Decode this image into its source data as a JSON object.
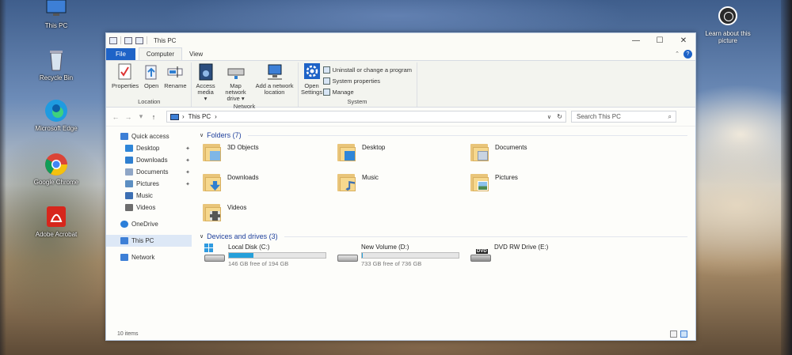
{
  "desktop": {
    "icons": [
      {
        "label": "This PC"
      },
      {
        "label": "Recycle Bin"
      },
      {
        "label": "Microsoft Edge"
      },
      {
        "label": "Google Chrome"
      },
      {
        "label": "Adobe Acrobat"
      }
    ],
    "learn_about": "Learn about this picture"
  },
  "window": {
    "title": "This PC",
    "controls": {
      "minimize": "—",
      "maximize": "☐",
      "close": "✕"
    }
  },
  "ribbon_tabs": [
    {
      "label": "File"
    },
    {
      "label": "Computer"
    },
    {
      "label": "View"
    }
  ],
  "help_label": "?",
  "collapse_label": "⌃",
  "ribbon": {
    "location": {
      "label": "Location",
      "buttons": [
        {
          "label": "Properties",
          "icon": "properties-icon"
        },
        {
          "label": "Open",
          "icon": "open-icon"
        },
        {
          "label": "Rename",
          "icon": "rename-icon"
        }
      ]
    },
    "network": {
      "label": "Network",
      "buttons": [
        {
          "label": "Access media ▾",
          "icon": "access-media-icon"
        },
        {
          "label": "Map network drive ▾",
          "icon": "map-drive-icon"
        },
        {
          "label": "Add a network location",
          "icon": "network-location-icon"
        }
      ]
    },
    "system": {
      "label": "System",
      "open_settings": "Open Settings",
      "items": [
        {
          "label": "Uninstall or change a program"
        },
        {
          "label": "System properties"
        },
        {
          "label": "Manage"
        }
      ]
    }
  },
  "address": {
    "back": "←",
    "forward": "→",
    "recent": "▾",
    "up": "↑",
    "path_sep1": "›",
    "path": "This PC",
    "path_sep2": "›",
    "dropdown": "∨",
    "refresh": "↻",
    "search_placeholder": "Search This PC",
    "search_icon": "⌕"
  },
  "nav_pane": {
    "items": [
      {
        "label": "Quick access",
        "pinned": false,
        "color": "#3d7fd6"
      },
      {
        "label": "Desktop",
        "pinned": true,
        "color": "#2f86d8"
      },
      {
        "label": "Downloads",
        "pinned": true,
        "color": "#2f7fd0"
      },
      {
        "label": "Documents",
        "pinned": true,
        "color": "#8fa6c6"
      },
      {
        "label": "Pictures",
        "pinned": true,
        "color": "#5d8fc2"
      },
      {
        "label": "Music",
        "pinned": false,
        "color": "#3c6fb3"
      },
      {
        "label": "Videos",
        "pinned": false,
        "color": "#6d6d6d"
      },
      {
        "label": "OneDrive",
        "pinned": false,
        "color": "#2c7fd9"
      },
      {
        "label": "This PC",
        "pinned": false,
        "color": "#3d7fd6"
      },
      {
        "label": "Network",
        "pinned": false,
        "color": "#3d7fd6"
      }
    ],
    "pin_glyph": "📌"
  },
  "folders_section": {
    "title": "Folders (7)",
    "chevron": "∨",
    "items": [
      {
        "label": "3D Objects",
        "badge_color": "#7fb6e6"
      },
      {
        "label": "Desktop",
        "badge_color": "#2f86d8"
      },
      {
        "label": "Documents",
        "badge_color": "#c9d4e2"
      },
      {
        "label": "Downloads",
        "badge_color": "#2f7fd0"
      },
      {
        "label": "Music",
        "badge_color": "#3c6fb3"
      },
      {
        "label": "Pictures",
        "badge_color": "#6ea3d6"
      },
      {
        "label": "Videos",
        "badge_color": "#555555"
      }
    ]
  },
  "drives_section": {
    "title": "Devices and drives (3)",
    "chevron": "∨",
    "items": [
      {
        "label": "Local Disk (C:)",
        "free": "146 GB free of 194 GB",
        "used_fraction": 0.25,
        "has_bar": true,
        "type": "system"
      },
      {
        "label": "New Volume (D:)",
        "free": "733 GB free of 736 GB",
        "used_fraction": 0.004,
        "has_bar": true,
        "type": "volume"
      },
      {
        "label": "DVD RW Drive (E:)",
        "free": "",
        "used_fraction": 0,
        "has_bar": false,
        "type": "dvd",
        "dvd_tag": "DVD"
      }
    ]
  },
  "status": {
    "items_count": "10 items"
  },
  "colors": {
    "accent": "#1e63c7",
    "drive_bar": "#26a0da",
    "folder": "#f6d88e"
  }
}
